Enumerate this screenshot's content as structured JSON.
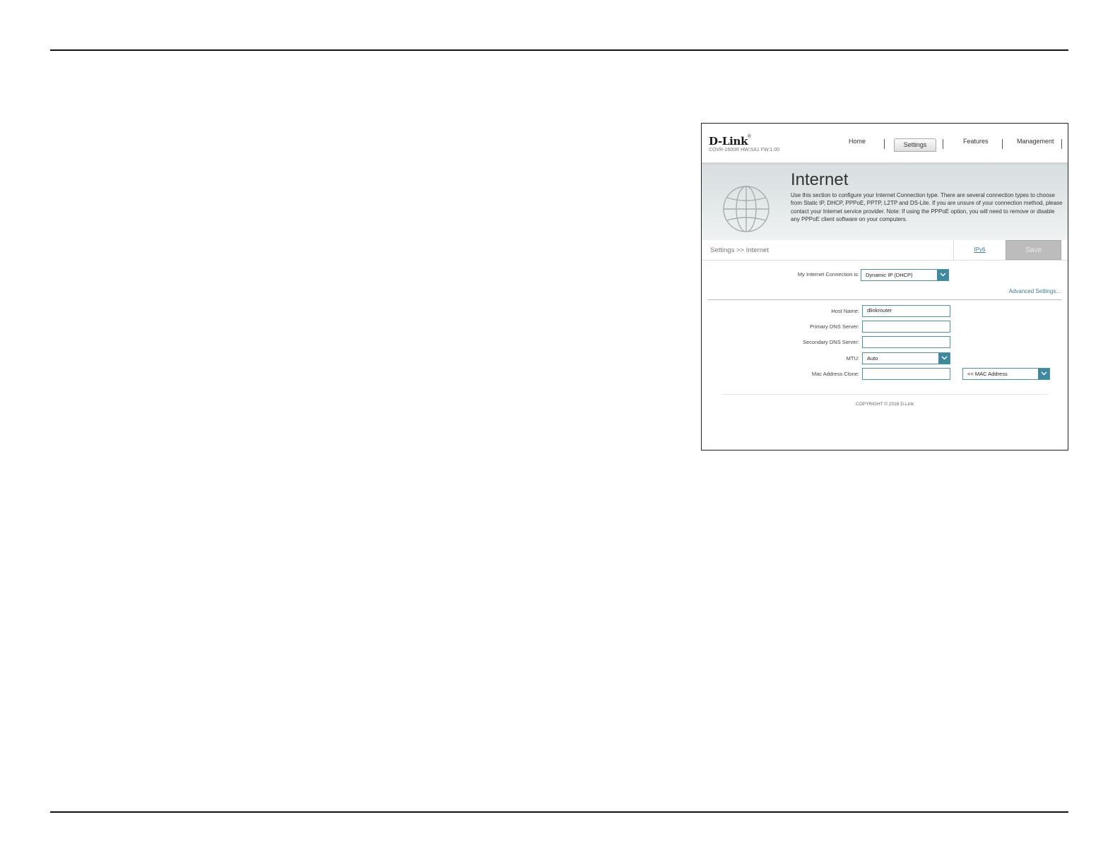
{
  "header": {
    "logo": "D-Link",
    "logo_mark": "®",
    "model": "COVR-2600R HW:SA1 FW:1.00",
    "nav": {
      "home": "Home",
      "settings": "Settings",
      "features": "Features",
      "management": "Management"
    }
  },
  "banner": {
    "title": "Internet",
    "description": "Use this section to configure your Internet Connection type. There are several connection types to choose from Static IP, DHCP, PPPoE, PPTP, L2TP and DS-Lite. If you are unsure of your connection method, please contact your Internet service provider. Note: If using the PPPoE option, you will need to remove or disable any PPPoE client software on your computers."
  },
  "breadcrumb": {
    "text": "Settings >> Internet",
    "ipv6_link": "IPv6",
    "save_label": "Save"
  },
  "form": {
    "connection_label": "My Internet Connection is:",
    "connection_value": "Dynamic IP (DHCP)",
    "advanced_link": "Advanced Settings...",
    "host_name_label": "Host Name:",
    "host_name_value": "dlinkrouter",
    "primary_dns_label": "Primary DNS Server:",
    "primary_dns_value": "",
    "secondary_dns_label": "Secondary DNS Server:",
    "secondary_dns_value": "",
    "mtu_label": "MTU:",
    "mtu_value": "Auto",
    "mac_clone_label": "Mac Address Clone:",
    "mac_clone_value": "",
    "mac_select_value": "<< MAC Address"
  },
  "footer": {
    "copyright": "COPYRIGHT © 2016 D-Link"
  },
  "icons": {
    "globe": "globe-icon",
    "dropdown": "chevron-down-icon"
  },
  "colors": {
    "accent": "#3d8aa0",
    "link": "#3a7c93",
    "save_disabled": "#bcbcbc"
  }
}
